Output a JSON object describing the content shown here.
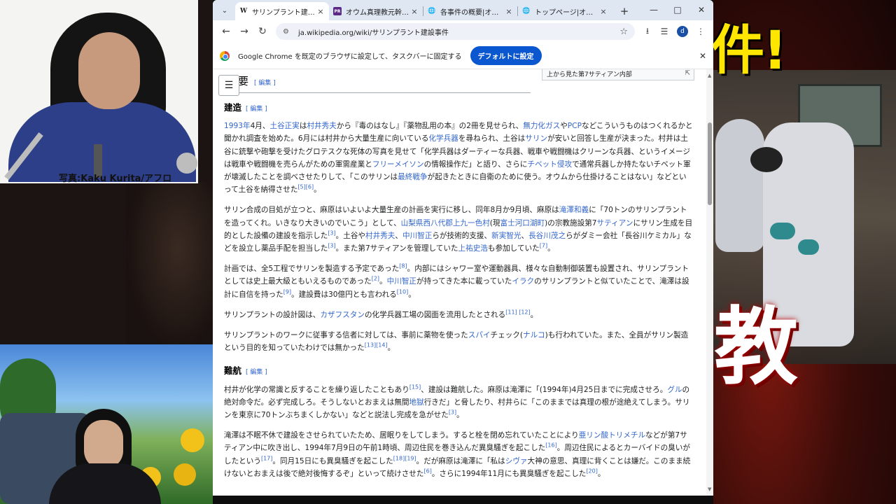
{
  "overlay": {
    "photo_caption": "写真:Kaku Kurita/アフロ",
    "headline_top": "件!",
    "headline_mid": "教"
  },
  "browser": {
    "tabs": [
      {
        "title": "サリンプラント建設事件",
        "favicon": "W",
        "active": true
      },
      {
        "title": "オウム真理教元幹部、死",
        "favicon": "PR",
        "active": false
      },
      {
        "title": "各事件の概要|オウム真理",
        "favicon": "globe",
        "active": false
      },
      {
        "title": "トップページ|オウム真理教",
        "favicon": "globe",
        "active": false
      }
    ],
    "url": "ja.wikipedia.org/wiki/サリンプラント建設事件",
    "profile_initial": "d",
    "infobar": {
      "message": "Google Chrome を既定のブラウザに設定して、タスクバーに固定する",
      "button": "デフォルトに設定"
    }
  },
  "article": {
    "top_heading": "要",
    "edit_label": "[ 編集 ]",
    "figure_caption": "上から見た第7サティアン内部",
    "sections": [
      {
        "heading": "建造",
        "paragraphs": [
          [
            [
              "1993年",
              "l"
            ],
            [
              "4月、",
              "t"
            ],
            [
              "土谷正実",
              "l"
            ],
            [
              "は",
              "t"
            ],
            [
              "村井秀夫",
              "l"
            ],
            [
              "から『毒のはなし』『薬物乱用の本』の2冊を見せられ、",
              "t"
            ],
            [
              "無力化ガス",
              "l"
            ],
            [
              "や",
              "t"
            ],
            [
              "PCP",
              "l"
            ],
            [
              "などこういうものはつくれるかと聞かれ調査を始めた。6月には村井から大量生産に向いている",
              "t"
            ],
            [
              "化学兵器",
              "l"
            ],
            [
              "を尋ねられ、土谷は",
              "t"
            ],
            [
              "サリン",
              "l"
            ],
            [
              "が安いと回答し生産が決まった。村井は土谷に銃撃や砲撃を受けたグロテスクな死体の写真を見せて「化学兵器はダーティーな兵器、戦車や戦闘機はクリーンな兵器、というイメージは戦車や戦闘機を売らんがための軍需産業と",
              "t"
            ],
            [
              "フリーメイソン",
              "l"
            ],
            [
              "の情報操作だ」と語り、さらに",
              "t"
            ],
            [
              "チベット侵攻",
              "l"
            ],
            [
              "で通常兵器しか持たないチベット軍が壊滅したことを調べさせたりして、「このサリンは",
              "t"
            ],
            [
              "最終戦争",
              "l"
            ],
            [
              "が起きたときに自衛のために使う。オウムから仕掛けることはない」などといって土谷を納得させた",
              "t"
            ],
            [
              "[5][6]",
              "s"
            ],
            [
              "。",
              "t"
            ]
          ],
          [
            [
              "サリン合成の目処が立つと、麻原はいよいよ大量生産の計画を実行に移し、同年8月か9月頃、麻原は",
              "t"
            ],
            [
              "滝澤和義",
              "l"
            ],
            [
              "に「70トンのサリンプラントを造ってくれ。いきなり大きいのでいこう」として、",
              "t"
            ],
            [
              "山梨県西八代郡上九一色村",
              "l"
            ],
            [
              "(現",
              "t"
            ],
            [
              "富士河口湖町",
              "l"
            ],
            [
              ")の宗教施設第7",
              "t"
            ],
            [
              "サティアン",
              "l"
            ],
            [
              "にサリン生成を目的とした設備の建設を指示した",
              "t"
            ],
            [
              "[3]",
              "s"
            ],
            [
              "。土谷や",
              "t"
            ],
            [
              "村井秀夫",
              "l"
            ],
            [
              "、",
              "t"
            ],
            [
              "中川智正",
              "l"
            ],
            [
              "らが技術的支援、",
              "t"
            ],
            [
              "新実智光",
              "l"
            ],
            [
              "、",
              "t"
            ],
            [
              "長谷川茂之",
              "l"
            ],
            [
              "らがダミー会社「長谷川ケミカル」などを設立し薬品手配を担当した",
              "t"
            ],
            [
              "[3]",
              "s"
            ],
            [
              "。また第7サティアンを管理していた",
              "t"
            ],
            [
              "上祐史浩",
              "l"
            ],
            [
              "も参加していた",
              "t"
            ],
            [
              "[7]",
              "s"
            ],
            [
              "。",
              "t"
            ]
          ],
          [
            [
              "計画では、全5工程でサリンを製造する予定であった",
              "t"
            ],
            [
              "[8]",
              "s"
            ],
            [
              "。内部にはシャワー室や運動器具、様々な自動制御装置も設置され、サリンプラントとしては史上最大級ともいえるものであった",
              "t"
            ],
            [
              "[2]",
              "s"
            ],
            [
              "。",
              "t"
            ],
            [
              "中川智正",
              "l"
            ],
            [
              "が持ってきた本に載っていた",
              "t"
            ],
            [
              "イラク",
              "l"
            ],
            [
              "のサリンプラントと似ていたことで、滝澤は設計に自信を持った",
              "t"
            ],
            [
              "[9]",
              "s"
            ],
            [
              "。建設費は30億円とも言われる",
              "t"
            ],
            [
              "[10]",
              "s"
            ],
            [
              "。",
              "t"
            ]
          ],
          [
            [
              "サリンプラントの設計図は、",
              "t"
            ],
            [
              "カザフスタン",
              "l"
            ],
            [
              "の化学兵器工場の図面を流用したとされる",
              "t"
            ],
            [
              "[11] [12]",
              "s"
            ],
            [
              "。",
              "t"
            ]
          ],
          [
            [
              "サリンプラントのワークに従事する信者に対しては、事前に薬物を使った",
              "t"
            ],
            [
              "スパイ",
              "l"
            ],
            [
              "チェック(",
              "t"
            ],
            [
              "ナルコ",
              "l"
            ],
            [
              ")も行われていた。また、全員がサリン製造という目的を知っていたわけでは無かった",
              "t"
            ],
            [
              "[13][14]",
              "s"
            ],
            [
              "。",
              "t"
            ]
          ]
        ]
      },
      {
        "heading": "難航",
        "paragraphs": [
          [
            [
              "村井が化学の常識と反することを繰り返したこともあり",
              "t"
            ],
            [
              "[15]",
              "s"
            ],
            [
              "、建設は難航した。麻原は滝澤に「(1994年)4月25日までに完成させろ。",
              "t"
            ],
            [
              "グル",
              "l"
            ],
            [
              "の絶対命令だ。必ず完成しろ。そうしないとおまえは無間",
              "t"
            ],
            [
              "地獄",
              "l"
            ],
            [
              "行きだ」と脅したり、村井らに「このままでは真理の根が途絶えてしまう。サリンを東京に70トンぶちまくしかない」などと説法し完成を急がせた",
              "t"
            ],
            [
              "[3]",
              "s"
            ],
            [
              "。",
              "t"
            ]
          ],
          [
            [
              "滝澤は不眠不休で建設をさせられていたため、居眠りをしてしまう。すると栓を閉め忘れていたことにより",
              "t"
            ],
            [
              "亜リン酸トリメチル",
              "l"
            ],
            [
              "などが第7サティアン中に吹き出し、1994年7月9日の午前1時頃、周辺住民を巻き込んだ異臭騒ぎを起こした",
              "t"
            ],
            [
              "[16]",
              "s"
            ],
            [
              "。周辺住民によるとカーバイド",
              "t"
            ],
            [
              "の臭いがしたという",
              "t"
            ],
            [
              "[17]",
              "s"
            ],
            [
              "。同月15日にも異臭騒ぎを起こした",
              "t"
            ],
            [
              "[18][19]",
              "s"
            ],
            [
              "。だが麻原は滝澤に「私は",
              "t"
            ],
            [
              "シヴァ",
              "l"
            ],
            [
              "大神の意思、真理に背くことは嫌だ。このまま続けないとおまえは後で絶対後悔するぞ」といって続けさせた",
              "t"
            ],
            [
              "[6]",
              "s"
            ],
            [
              "。さらに1994年11月にも異臭騒ぎを起こした",
              "t"
            ],
            [
              "[20]",
              "s"
            ],
            [
              "。",
              "t"
            ]
          ]
        ]
      }
    ]
  }
}
